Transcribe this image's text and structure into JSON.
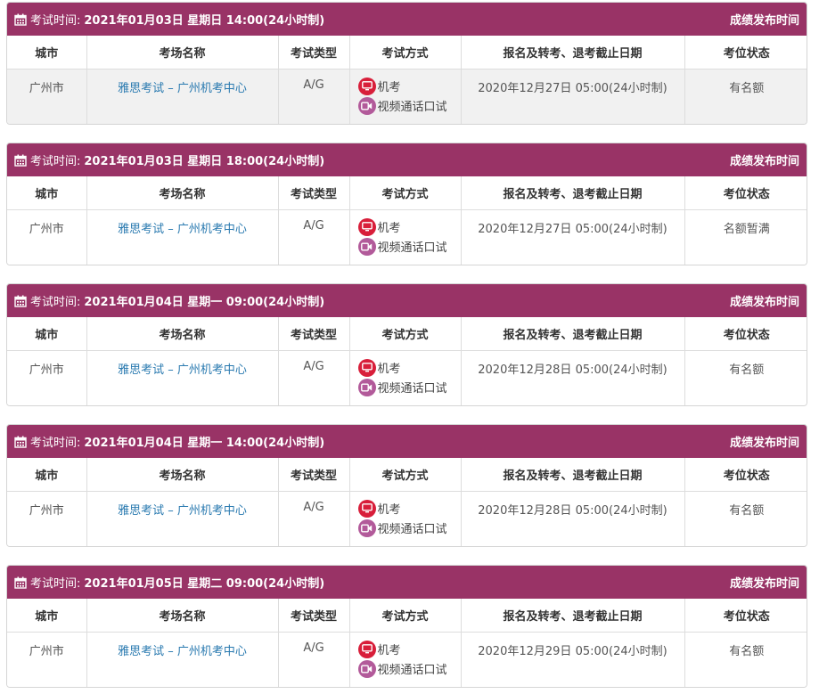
{
  "header_prefix": "考试时间:",
  "results_label": "成绩发布时间",
  "columns": [
    "城市",
    "考场名称",
    "考试类型",
    "考试方式",
    "报名及转考、退考截止日期",
    "考位状态"
  ],
  "modes": {
    "computer": "机考",
    "video": "视频通话口试"
  },
  "sessions": [
    {
      "time": "2021年01月03日 星期日 14:00(24小时制)",
      "city": "广州市",
      "venue": "雅思考试 – 广州机考中心",
      "type": "A/G",
      "deadline": "2020年12月27日 05:00(24小时制)",
      "status": "有名额"
    },
    {
      "time": "2021年01月03日 星期日 18:00(24小时制)",
      "city": "广州市",
      "venue": "雅思考试 – 广州机考中心",
      "type": "A/G",
      "deadline": "2020年12月27日 05:00(24小时制)",
      "status": "名额暂满"
    },
    {
      "time": "2021年01月04日 星期一 09:00(24小时制)",
      "city": "广州市",
      "venue": "雅思考试 – 广州机考中心",
      "type": "A/G",
      "deadline": "2020年12月28日 05:00(24小时制)",
      "status": "有名额"
    },
    {
      "time": "2021年01月04日 星期一 14:00(24小时制)",
      "city": "广州市",
      "venue": "雅思考试 – 广州机考中心",
      "type": "A/G",
      "deadline": "2020年12月28日 05:00(24小时制)",
      "status": "有名额"
    },
    {
      "time": "2021年01月05日 星期二 09:00(24小时制)",
      "city": "广州市",
      "venue": "雅思考试 – 广州机考中心",
      "type": "A/G",
      "deadline": "2020年12月29日 05:00(24小时制)",
      "status": "有名额"
    }
  ]
}
